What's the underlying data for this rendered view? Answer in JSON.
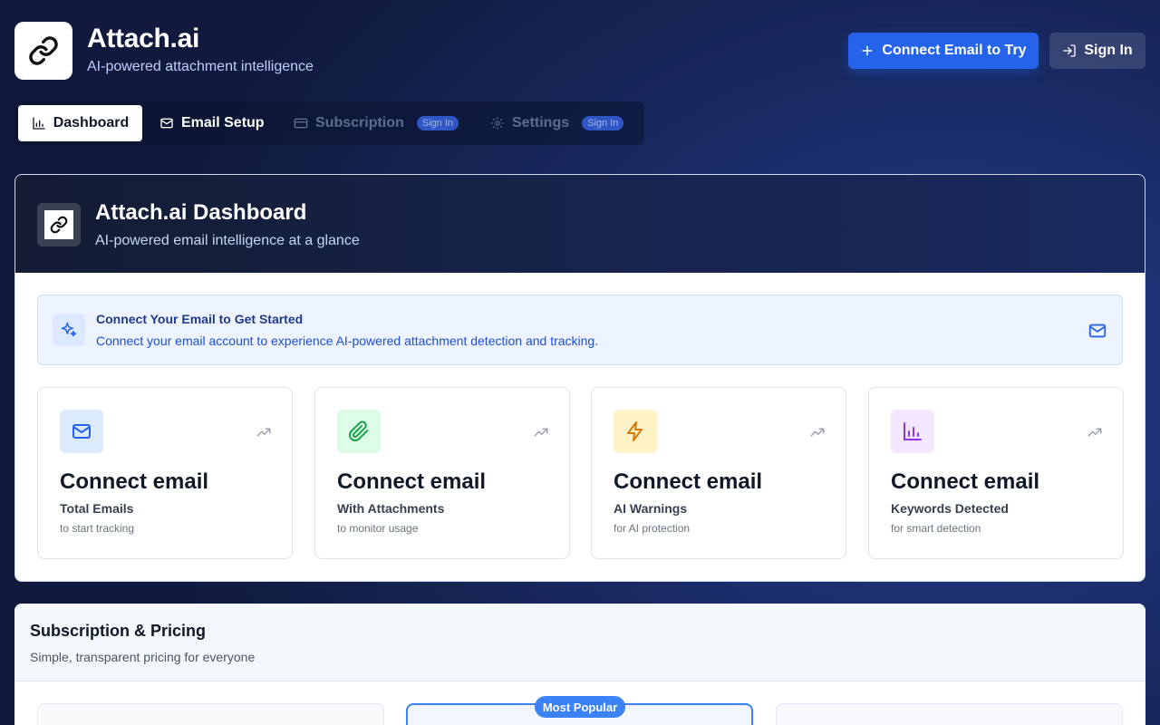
{
  "app": {
    "title": "Attach.ai",
    "subtitle": "AI-powered attachment intelligence"
  },
  "header": {
    "connect_label": "Connect Email to Try",
    "signin_label": "Sign In"
  },
  "tabs": [
    {
      "label": "Dashboard",
      "icon": "bar-chart-icon",
      "active": true
    },
    {
      "label": "Email Setup",
      "icon": "mail-icon",
      "active": false
    },
    {
      "label": "Subscription",
      "icon": "credit-card-icon",
      "disabled": true,
      "badge": "Sign In"
    },
    {
      "label": "Settings",
      "icon": "gear-icon",
      "disabled": true,
      "badge": "Sign In"
    }
  ],
  "dashboard": {
    "title": "Attach.ai Dashboard",
    "subtitle": "AI-powered email intelligence at a glance",
    "notice": {
      "title": "Connect Your Email to Get Started",
      "text": "Connect your email account to experience AI-powered attachment detection and tracking."
    },
    "stats": [
      {
        "value": "Connect email",
        "label": "Total Emails",
        "hint": "to start tracking",
        "icon": "mail-icon",
        "color": "#2563eb",
        "bg": "#dbeafe"
      },
      {
        "value": "Connect email",
        "label": "With Attachments",
        "hint": "to monitor usage",
        "icon": "paperclip-icon",
        "color": "#16a34a",
        "bg": "#dcfce7"
      },
      {
        "value": "Connect email",
        "label": "AI Warnings",
        "hint": "for AI protection",
        "icon": "lightning-icon",
        "color": "#d97706",
        "bg": "#fef3c7"
      },
      {
        "value": "Connect email",
        "label": "Keywords Detected",
        "hint": "for smart detection",
        "icon": "bar-chart-icon",
        "color": "#9333ea",
        "bg": "#f3e8ff"
      }
    ]
  },
  "subscription": {
    "title": "Subscription & Pricing",
    "subtitle": "Simple, transparent pricing for everyone",
    "popular_badge": "Most Popular"
  },
  "colors": {
    "accent": "#2563eb",
    "background": "#15224f"
  }
}
